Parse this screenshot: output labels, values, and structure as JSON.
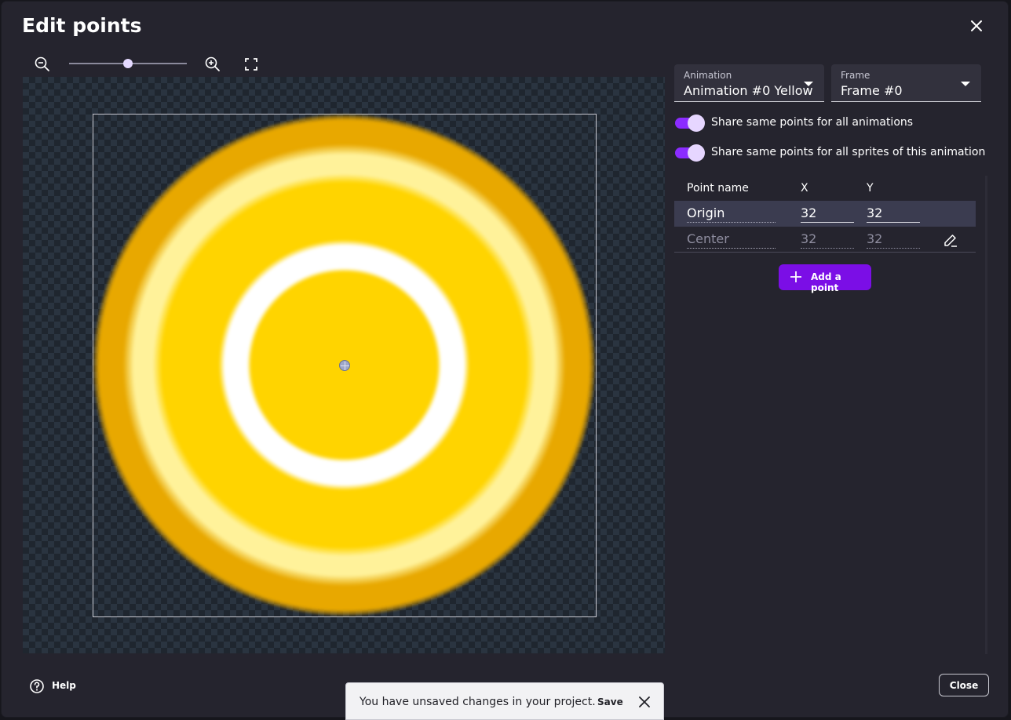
{
  "dialog": {
    "title": "Edit points",
    "close_icon": "close-icon"
  },
  "toolbar": {
    "zoom_out_icon": "zoom-out-icon",
    "zoom_in_icon": "zoom-in-icon",
    "fit_icon": "fullscreen-fit-icon",
    "zoom_level": 0.5
  },
  "selectors": {
    "animation": {
      "label": "Animation",
      "value": "Animation #0 Yellow"
    },
    "frame": {
      "label": "Frame",
      "value": "Frame #0"
    }
  },
  "toggles": [
    {
      "label": "Share same points for all animations",
      "on": true
    },
    {
      "label": "Share same points for all sprites of this animation",
      "on": true
    }
  ],
  "points_table": {
    "headers": {
      "name": "Point name",
      "x": "X",
      "y": "Y"
    },
    "rows": [
      {
        "name": "Origin",
        "x": "32",
        "y": "32",
        "selected": true
      },
      {
        "name": "Center",
        "x": "32",
        "y": "32",
        "selected": false
      }
    ],
    "edit_icon": "pencil-icon"
  },
  "add_point_label": "Add a point",
  "footer": {
    "help_label": "Help",
    "help_icon": "help-circle-icon",
    "close_label": "Close"
  },
  "snackbar": {
    "message": "You have unsaved changes in your project.",
    "action_label": "Save",
    "close_icon": "close-icon"
  },
  "colors": {
    "accent": "#7b0ee6",
    "toggle": "#8b2cff",
    "background": "#25242e",
    "coin_yellow": "#ffd400",
    "coin_orange": "#e8a800"
  }
}
